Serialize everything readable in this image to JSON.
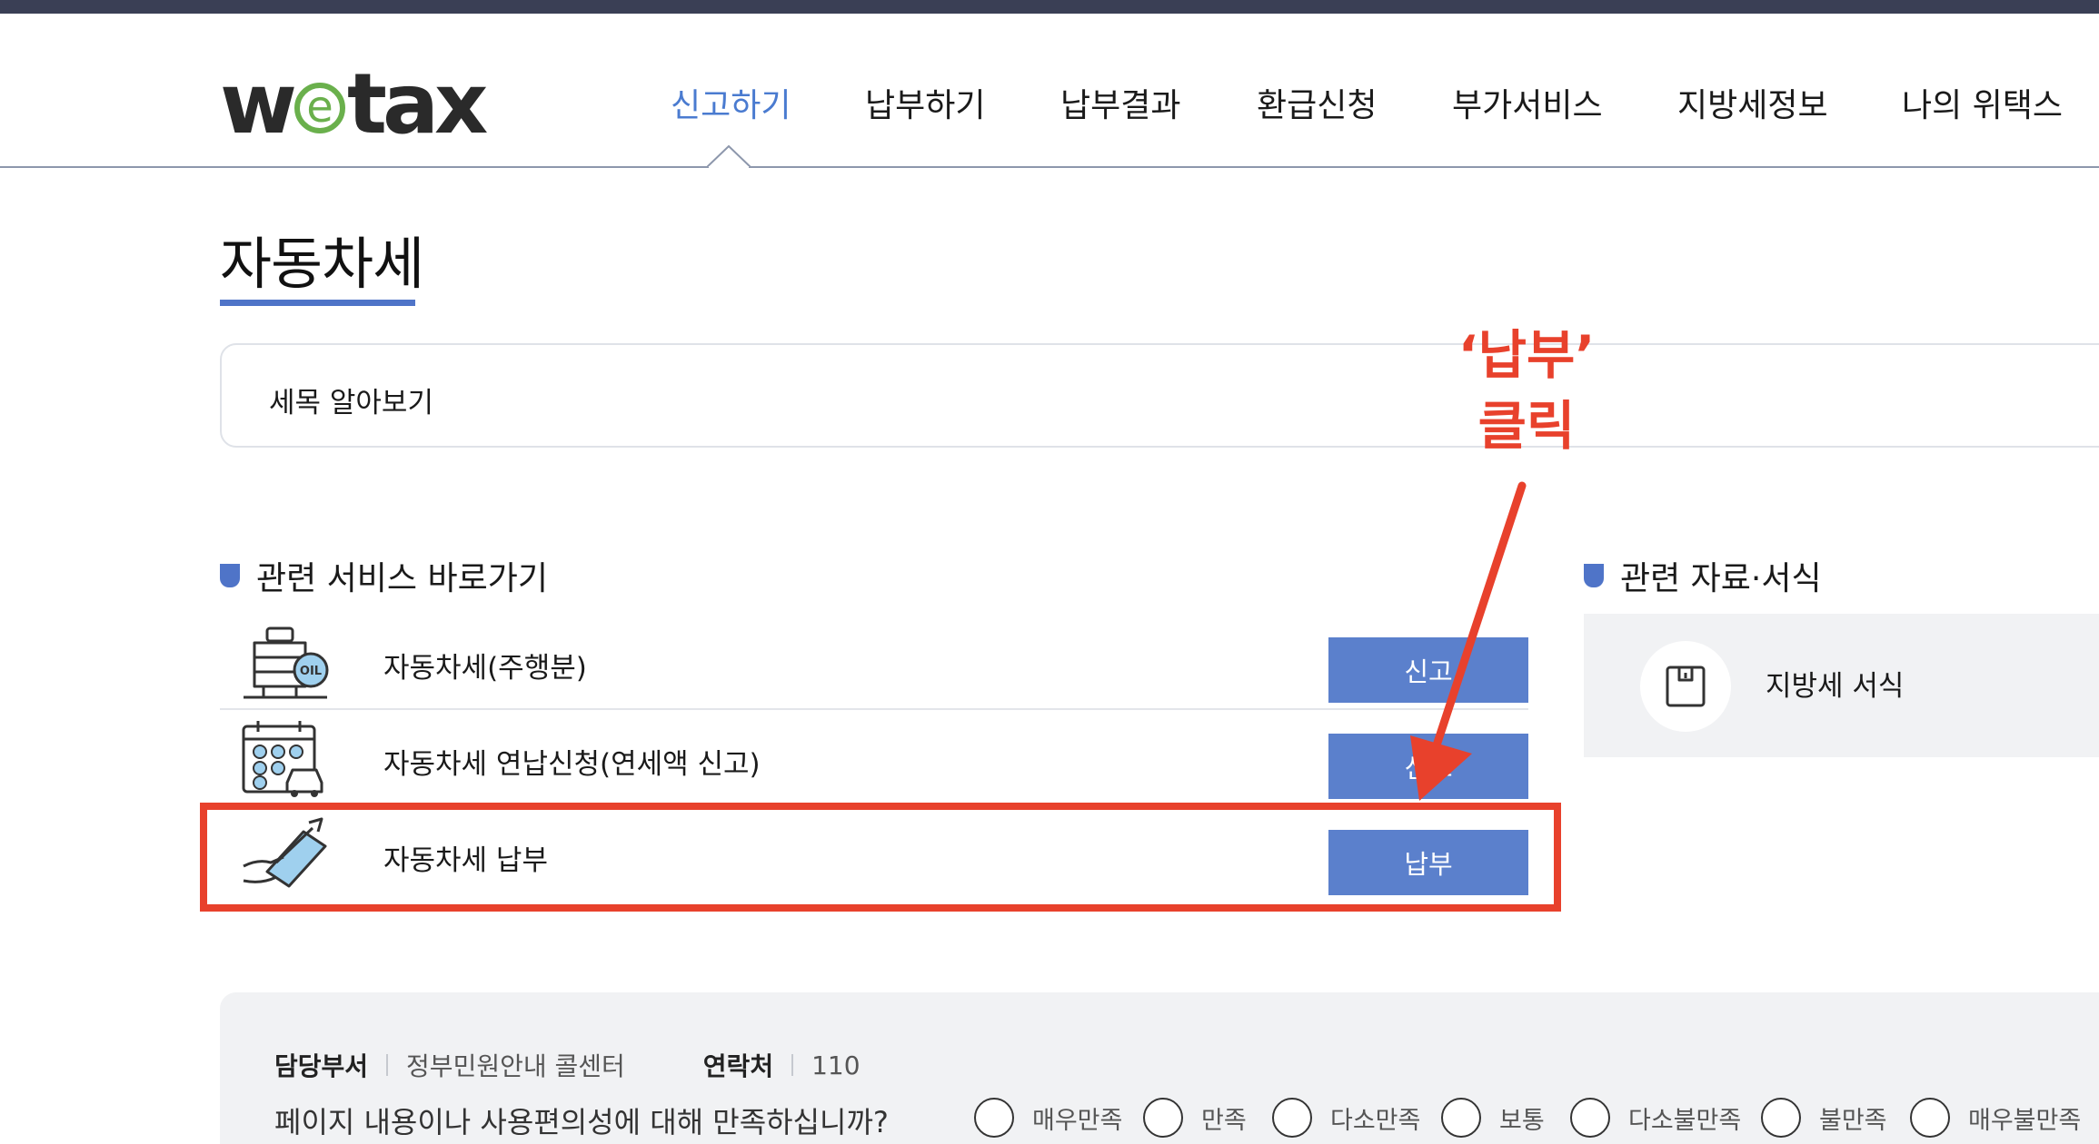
{
  "brand": {
    "logo_pre": "w",
    "logo_e": "e",
    "logo_post": "tax"
  },
  "nav": {
    "items": [
      {
        "label": "신고하기",
        "active": true
      },
      {
        "label": "납부하기",
        "active": false
      },
      {
        "label": "납부결과",
        "active": false
      },
      {
        "label": "환급신청",
        "active": false
      },
      {
        "label": "부가서비스",
        "active": false
      },
      {
        "label": "지방세정보",
        "active": false
      },
      {
        "label": "나의 위택스",
        "active": false
      }
    ]
  },
  "page": {
    "title": "자동차세",
    "tax_info_label": "세목 알아보기"
  },
  "services": {
    "title": "관련 서비스 바로가기",
    "rows": [
      {
        "label": "자동차세(주행분)",
        "button": "신고",
        "icon": "oil-tank-icon"
      },
      {
        "label": "자동차세 연납신청(연세액 신고)",
        "button": "신고",
        "icon": "calendar-car-icon"
      },
      {
        "label": "자동차세 납부",
        "button": "납부",
        "icon": "card-payment-icon"
      }
    ]
  },
  "forms": {
    "title": "관련 자료·서식",
    "item_label": "지방세 서식",
    "icon": "document-form-icon"
  },
  "annotation": {
    "line1": "‘납부’",
    "line2": "클릭",
    "color": "#e8412c"
  },
  "footer": {
    "dept_label": "담당부서",
    "dept_value": "정부민원안내 콜센터",
    "contact_label": "연락처",
    "contact_value": "110",
    "survey_question": "페이지 내용이나 사용편의성에 대해 만족하십니까?",
    "survey_options": [
      "매우만족",
      "만족",
      "다소만족",
      "보통",
      "다소불만족",
      "불만족",
      "매우불만족"
    ]
  },
  "colors": {
    "accent": "#4f74c8",
    "nav_active": "#4a7bd0",
    "button": "#5b80cc",
    "highlight": "#e8412c",
    "logo_green": "#6ab04c",
    "topbar": "#3a3f55"
  }
}
